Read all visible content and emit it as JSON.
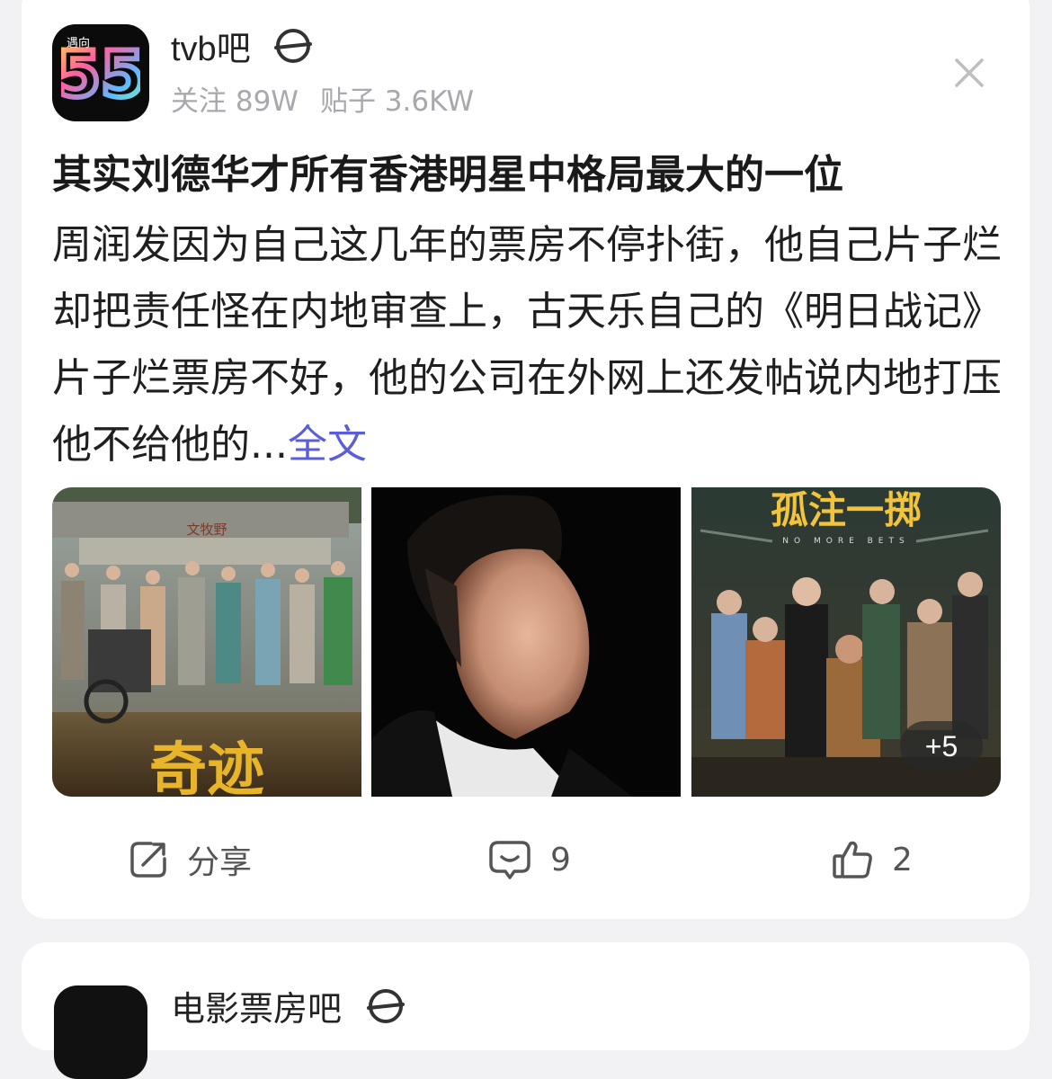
{
  "post": {
    "forum_name": "tvb吧",
    "avatar_tag": "遇向",
    "avatar_number": "55",
    "stats": {
      "followers": "关注 89W",
      "posts": "贴子 3.6KW"
    },
    "title": "其实刘德华才所有香港明星中格局最大的一位",
    "body": "周润发因为自己这几年的票房不停扑街，他自己片子烂却把责任怪在内地审查上，古天乐自己的《明日战记》片子烂票房不好，他的公司在外网上还发帖说内地打压他不给他的...",
    "more_link": "全文",
    "images": [
      {
        "poster_text": "文牧野",
        "caption": "奇迹"
      },
      {
        "caption": ""
      },
      {
        "poster_title": "孤注一掷",
        "poster_subtitle": "NO MORE BETS",
        "extra_count": "+5"
      }
    ],
    "actions": {
      "share": "分享",
      "comments": "9",
      "likes": "2"
    }
  },
  "next_post": {
    "forum_name": "电影票房吧"
  }
}
